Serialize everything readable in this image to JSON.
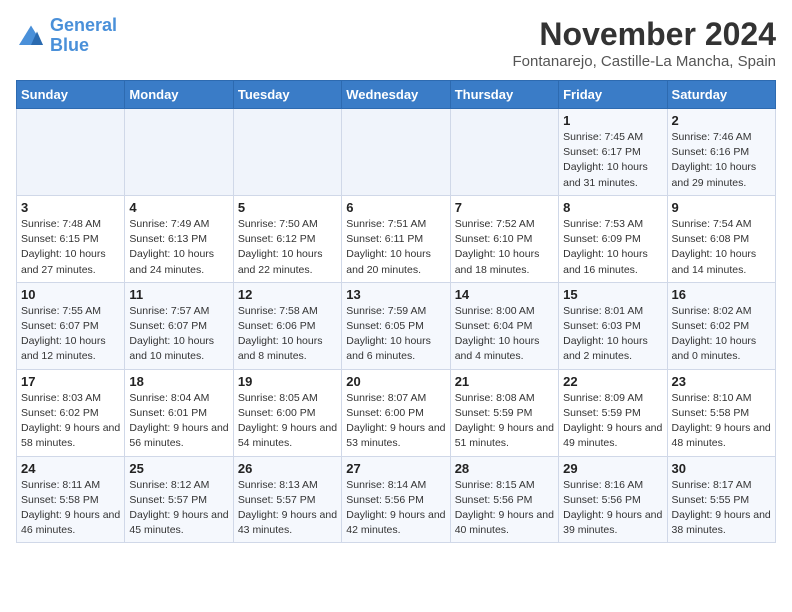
{
  "logo": {
    "line1": "General",
    "line2": "Blue"
  },
  "title": "November 2024",
  "location": "Fontanarejo, Castille-La Mancha, Spain",
  "days_of_week": [
    "Sunday",
    "Monday",
    "Tuesday",
    "Wednesday",
    "Thursday",
    "Friday",
    "Saturday"
  ],
  "weeks": [
    [
      {
        "day": "",
        "info": ""
      },
      {
        "day": "",
        "info": ""
      },
      {
        "day": "",
        "info": ""
      },
      {
        "day": "",
        "info": ""
      },
      {
        "day": "",
        "info": ""
      },
      {
        "day": "1",
        "info": "Sunrise: 7:45 AM\nSunset: 6:17 PM\nDaylight: 10 hours and 31 minutes."
      },
      {
        "day": "2",
        "info": "Sunrise: 7:46 AM\nSunset: 6:16 PM\nDaylight: 10 hours and 29 minutes."
      }
    ],
    [
      {
        "day": "3",
        "info": "Sunrise: 7:48 AM\nSunset: 6:15 PM\nDaylight: 10 hours and 27 minutes."
      },
      {
        "day": "4",
        "info": "Sunrise: 7:49 AM\nSunset: 6:13 PM\nDaylight: 10 hours and 24 minutes."
      },
      {
        "day": "5",
        "info": "Sunrise: 7:50 AM\nSunset: 6:12 PM\nDaylight: 10 hours and 22 minutes."
      },
      {
        "day": "6",
        "info": "Sunrise: 7:51 AM\nSunset: 6:11 PM\nDaylight: 10 hours and 20 minutes."
      },
      {
        "day": "7",
        "info": "Sunrise: 7:52 AM\nSunset: 6:10 PM\nDaylight: 10 hours and 18 minutes."
      },
      {
        "day": "8",
        "info": "Sunrise: 7:53 AM\nSunset: 6:09 PM\nDaylight: 10 hours and 16 minutes."
      },
      {
        "day": "9",
        "info": "Sunrise: 7:54 AM\nSunset: 6:08 PM\nDaylight: 10 hours and 14 minutes."
      }
    ],
    [
      {
        "day": "10",
        "info": "Sunrise: 7:55 AM\nSunset: 6:07 PM\nDaylight: 10 hours and 12 minutes."
      },
      {
        "day": "11",
        "info": "Sunrise: 7:57 AM\nSunset: 6:07 PM\nDaylight: 10 hours and 10 minutes."
      },
      {
        "day": "12",
        "info": "Sunrise: 7:58 AM\nSunset: 6:06 PM\nDaylight: 10 hours and 8 minutes."
      },
      {
        "day": "13",
        "info": "Sunrise: 7:59 AM\nSunset: 6:05 PM\nDaylight: 10 hours and 6 minutes."
      },
      {
        "day": "14",
        "info": "Sunrise: 8:00 AM\nSunset: 6:04 PM\nDaylight: 10 hours and 4 minutes."
      },
      {
        "day": "15",
        "info": "Sunrise: 8:01 AM\nSunset: 6:03 PM\nDaylight: 10 hours and 2 minutes."
      },
      {
        "day": "16",
        "info": "Sunrise: 8:02 AM\nSunset: 6:02 PM\nDaylight: 10 hours and 0 minutes."
      }
    ],
    [
      {
        "day": "17",
        "info": "Sunrise: 8:03 AM\nSunset: 6:02 PM\nDaylight: 9 hours and 58 minutes."
      },
      {
        "day": "18",
        "info": "Sunrise: 8:04 AM\nSunset: 6:01 PM\nDaylight: 9 hours and 56 minutes."
      },
      {
        "day": "19",
        "info": "Sunrise: 8:05 AM\nSunset: 6:00 PM\nDaylight: 9 hours and 54 minutes."
      },
      {
        "day": "20",
        "info": "Sunrise: 8:07 AM\nSunset: 6:00 PM\nDaylight: 9 hours and 53 minutes."
      },
      {
        "day": "21",
        "info": "Sunrise: 8:08 AM\nSunset: 5:59 PM\nDaylight: 9 hours and 51 minutes."
      },
      {
        "day": "22",
        "info": "Sunrise: 8:09 AM\nSunset: 5:59 PM\nDaylight: 9 hours and 49 minutes."
      },
      {
        "day": "23",
        "info": "Sunrise: 8:10 AM\nSunset: 5:58 PM\nDaylight: 9 hours and 48 minutes."
      }
    ],
    [
      {
        "day": "24",
        "info": "Sunrise: 8:11 AM\nSunset: 5:58 PM\nDaylight: 9 hours and 46 minutes."
      },
      {
        "day": "25",
        "info": "Sunrise: 8:12 AM\nSunset: 5:57 PM\nDaylight: 9 hours and 45 minutes."
      },
      {
        "day": "26",
        "info": "Sunrise: 8:13 AM\nSunset: 5:57 PM\nDaylight: 9 hours and 43 minutes."
      },
      {
        "day": "27",
        "info": "Sunrise: 8:14 AM\nSunset: 5:56 PM\nDaylight: 9 hours and 42 minutes."
      },
      {
        "day": "28",
        "info": "Sunrise: 8:15 AM\nSunset: 5:56 PM\nDaylight: 9 hours and 40 minutes."
      },
      {
        "day": "29",
        "info": "Sunrise: 8:16 AM\nSunset: 5:56 PM\nDaylight: 9 hours and 39 minutes."
      },
      {
        "day": "30",
        "info": "Sunrise: 8:17 AM\nSunset: 5:55 PM\nDaylight: 9 hours and 38 minutes."
      }
    ]
  ]
}
